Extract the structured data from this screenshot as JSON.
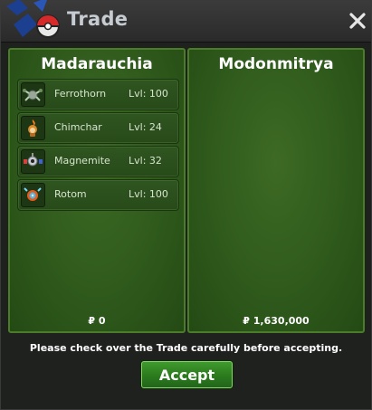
{
  "window": {
    "title": "Trade",
    "close_glyph": "✕",
    "logo_icon": "pokeball-logo-icon"
  },
  "left_panel": {
    "trainer": "Madarauchia",
    "pokemon": [
      {
        "name": "Ferrothorn",
        "level": "Lvl: 100",
        "icon": "ferrothorn-icon"
      },
      {
        "name": "Chimchar",
        "level": "Lvl: 24",
        "icon": "chimchar-icon"
      },
      {
        "name": "Magnemite",
        "level": "Lvl: 32",
        "icon": "magnemite-icon"
      },
      {
        "name": "Rotom",
        "level": "Lvl: 100",
        "icon": "rotom-icon"
      }
    ],
    "currency_symbol": "₽",
    "money": "0"
  },
  "right_panel": {
    "trainer": "Modonmitrya",
    "pokemon": [],
    "currency_symbol": "₽",
    "money": "1,630,000"
  },
  "notice": "Please check over the Trade carefully before accepting.",
  "accept_label": "Accept",
  "colors": {
    "panel_green": "#2f5a1c",
    "panel_border": "#4a7c2a",
    "accept_green": "#2b7a1d",
    "title_text": "#c7ccd2"
  }
}
